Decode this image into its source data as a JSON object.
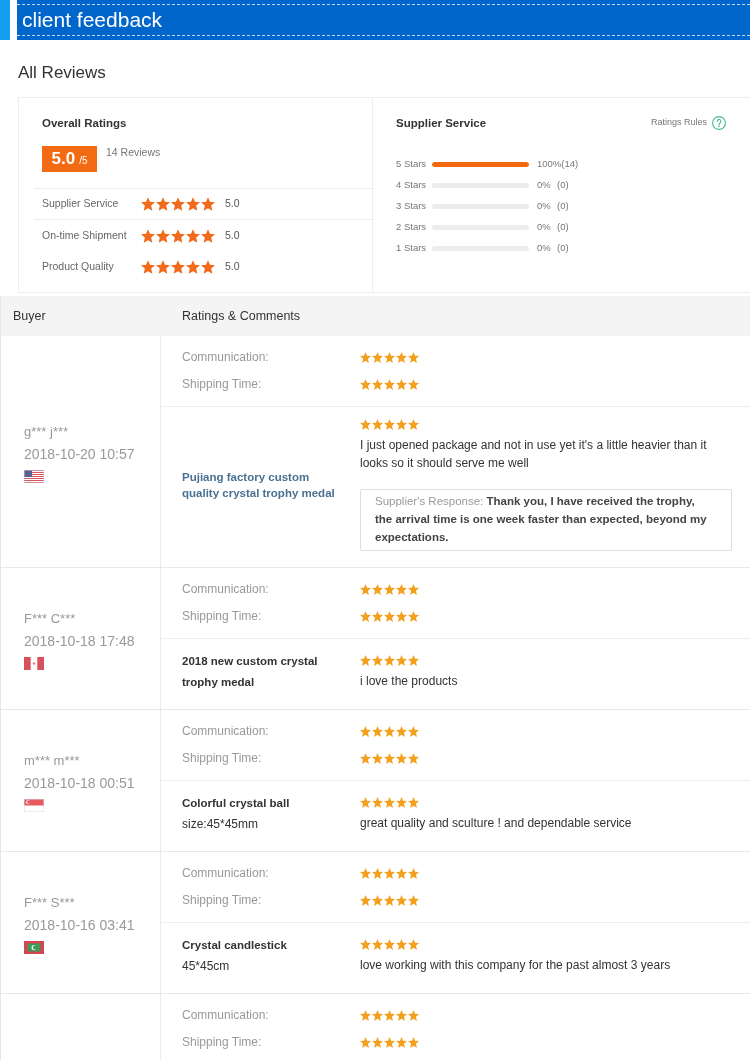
{
  "header": {
    "title": "client feedback"
  },
  "page_title": "All Reviews",
  "summary": {
    "overall": {
      "title": "Overall Ratings",
      "score": "5.0",
      "scale": "/5",
      "review_count": "14 Reviews",
      "categories": [
        {
          "label": "Supplier Service",
          "stars": 5,
          "value": "5.0"
        },
        {
          "label": "On-time Shipment",
          "stars": 5,
          "value": "5.0"
        },
        {
          "label": "Product Quality",
          "stars": 5,
          "value": "5.0"
        }
      ]
    },
    "breakdown": {
      "title": "Supplier Service",
      "rules_link": "Ratings Rules",
      "bars": [
        {
          "label": "5 Stars",
          "level": 1,
          "percent": "100%",
          "count": "(14)"
        },
        {
          "label": "4 Stars",
          "level": 0,
          "percent": "0%",
          "count": "(0)"
        },
        {
          "label": "3 Stars",
          "level": 0,
          "percent": "0%",
          "count": "(0)"
        },
        {
          "label": "2 Stars",
          "level": 0,
          "percent": "0%",
          "count": "(0)"
        },
        {
          "label": "1 Stars",
          "level": 0,
          "percent": "0%",
          "count": "(0)"
        }
      ]
    }
  },
  "table": {
    "columns": [
      "Buyer",
      "Ratings & Comments"
    ],
    "reviews": [
      {
        "buyer": "g*** j***",
        "date": "2018-10-20 10:57",
        "flag": {
          "kind": "us"
        },
        "ratings": [
          {
            "label": "Communication:",
            "stars": 5
          },
          {
            "label": "Shipping Time:",
            "stars": 5
          }
        ],
        "product": {
          "name": "Pujiang factory custom quality crystal trophy medal",
          "linked": true
        },
        "comment": {
          "stars": 5,
          "text": "I just opened package and not in use yet it's a little heavier than it looks so it should serve me well"
        },
        "response": "Supplier's Response: **Thank you, I have received the trophy, the arrival time is one week faster than expected, beyond my expectations.**"
      },
      {
        "buyer": "F*** C***",
        "date": "2018-10-18 17:48",
        "flag": {
          "kind": "pe"
        },
        "ratings": [
          {
            "label": "Communication:",
            "stars": 5
          },
          {
            "label": "Shipping Time:",
            "stars": 5
          }
        ],
        "product": {
          "name": "2018 new custom crystal trophy medal",
          "linked": false
        },
        "comment": {
          "stars": 5,
          "text": "i love the products"
        }
      },
      {
        "buyer": "m*** m***",
        "date": "2018-10-18 00:51",
        "flag": {
          "kind": "sg"
        },
        "ratings": [
          {
            "label": "Communication:",
            "stars": 5
          },
          {
            "label": "Shipping Time:",
            "stars": 5
          }
        ],
        "product": {
          "name": "Colorful crystal ball",
          "spec": "size:45*45mm",
          "linked": false
        },
        "comment": {
          "stars": 5,
          "text": "great quality and sculture ! and dependable service"
        }
      },
      {
        "buyer": "F*** S***",
        "date": "2018-10-16 03:41",
        "flag": {
          "kind": "mv"
        },
        "ratings": [
          {
            "label": "Communication:",
            "stars": 5
          },
          {
            "label": "Shipping Time:",
            "stars": 5
          }
        ],
        "product": {
          "name": "Crystal candlestick",
          "spec": "45*45cm",
          "linked": false
        },
        "comment": {
          "stars": 5,
          "text": "love working with this company for the past almost 3 years"
        }
      },
      {
        "ratings": [
          {
            "label": "Communication:",
            "stars": 5
          },
          {
            "label": "Shipping Time:",
            "stars": 5
          }
        ]
      }
    ]
  }
}
